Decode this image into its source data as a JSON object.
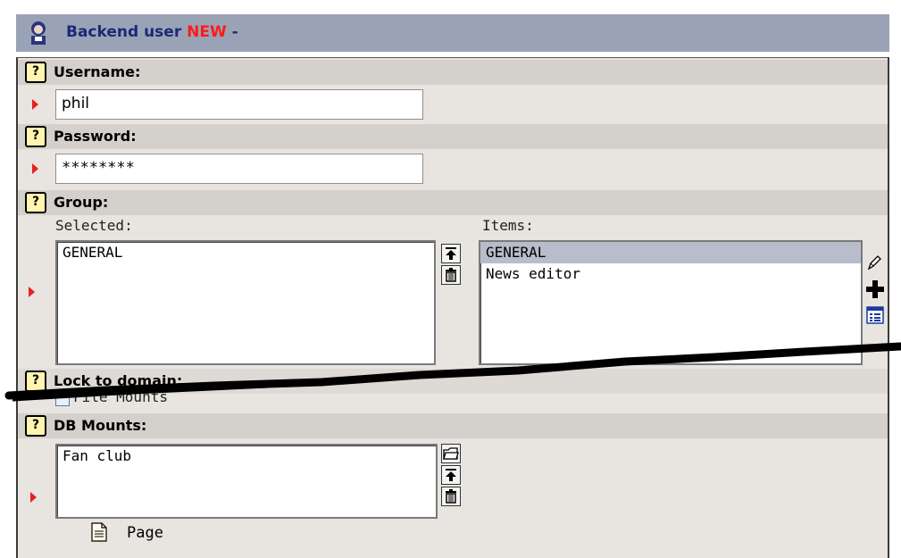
{
  "header": {
    "title": "Backend user",
    "new_tag": "NEW",
    "suffix": "-"
  },
  "username": {
    "label": "Username:",
    "value": "phil"
  },
  "password": {
    "label": "Password:",
    "value": "********"
  },
  "group": {
    "label": "Group:",
    "selected_label": "Selected:",
    "items_label": "Items:",
    "selected": [
      "GENERAL"
    ],
    "items": [
      "GENERAL",
      "News editor"
    ],
    "highlighted_item": "GENERAL"
  },
  "lock_to_domain": {
    "label": "Lock to domain:",
    "file_mounts_label": "File Mounts"
  },
  "db_mounts": {
    "label": "DB Mounts:",
    "selected": [
      "Fan club"
    ],
    "page_label": "Page"
  },
  "icons": [
    "user-icon",
    "help-icon",
    "move-top-icon",
    "delete-icon",
    "edit-pencil-icon",
    "add-icon",
    "list-icon",
    "browse-folder-icon",
    "page-icon"
  ],
  "colors": {
    "header_bg": "#9aa3b5",
    "title_blue": "#1a2a78",
    "new_red": "#ff1a1a",
    "form_bg": "#e8e4df",
    "section_bg": "#d4d0cc",
    "selected_row": "#b9bccb"
  }
}
